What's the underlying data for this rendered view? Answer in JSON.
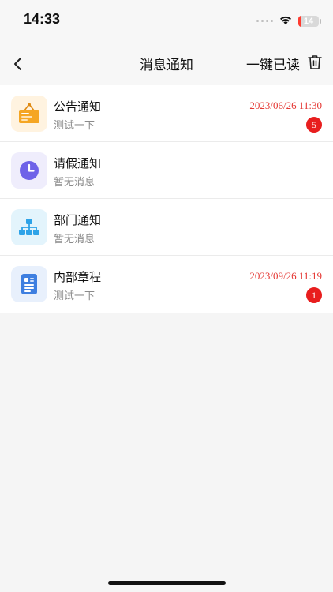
{
  "status_bar": {
    "time": "14:33",
    "battery_level": "14",
    "battery_fraction": 0.14
  },
  "nav": {
    "title": "消息通知",
    "mark_all_read": "一键已读",
    "back_icon": "chevron-left-icon",
    "trash_icon": "trash-icon"
  },
  "items": [
    {
      "title": "公告通知",
      "subtitle": "测试一下",
      "time": "2023/06/26 11:30",
      "badge": "5",
      "icon": "announcement-board-icon",
      "icon_bg": "#fff3e0",
      "icon_color": "#f5a623"
    },
    {
      "title": "请假通知",
      "subtitle": "暂无消息",
      "time": "",
      "badge": "",
      "icon": "clock-icon",
      "icon_bg": "#efedfc",
      "icon_color": "#6e62e8"
    },
    {
      "title": "部门通知",
      "subtitle": "暂无消息",
      "time": "",
      "badge": "",
      "icon": "org-chart-icon",
      "icon_bg": "#e3f4fc",
      "icon_color": "#2ea3e8"
    },
    {
      "title": "内部章程",
      "subtitle": "测试一下",
      "time": "2023/09/26 11:19",
      "badge": "1",
      "icon": "document-icon",
      "icon_bg": "#e8f0fc",
      "icon_color": "#3e7fe0"
    }
  ],
  "colors": {
    "time_red": "#e53935",
    "badge_red": "#e81e1e"
  }
}
